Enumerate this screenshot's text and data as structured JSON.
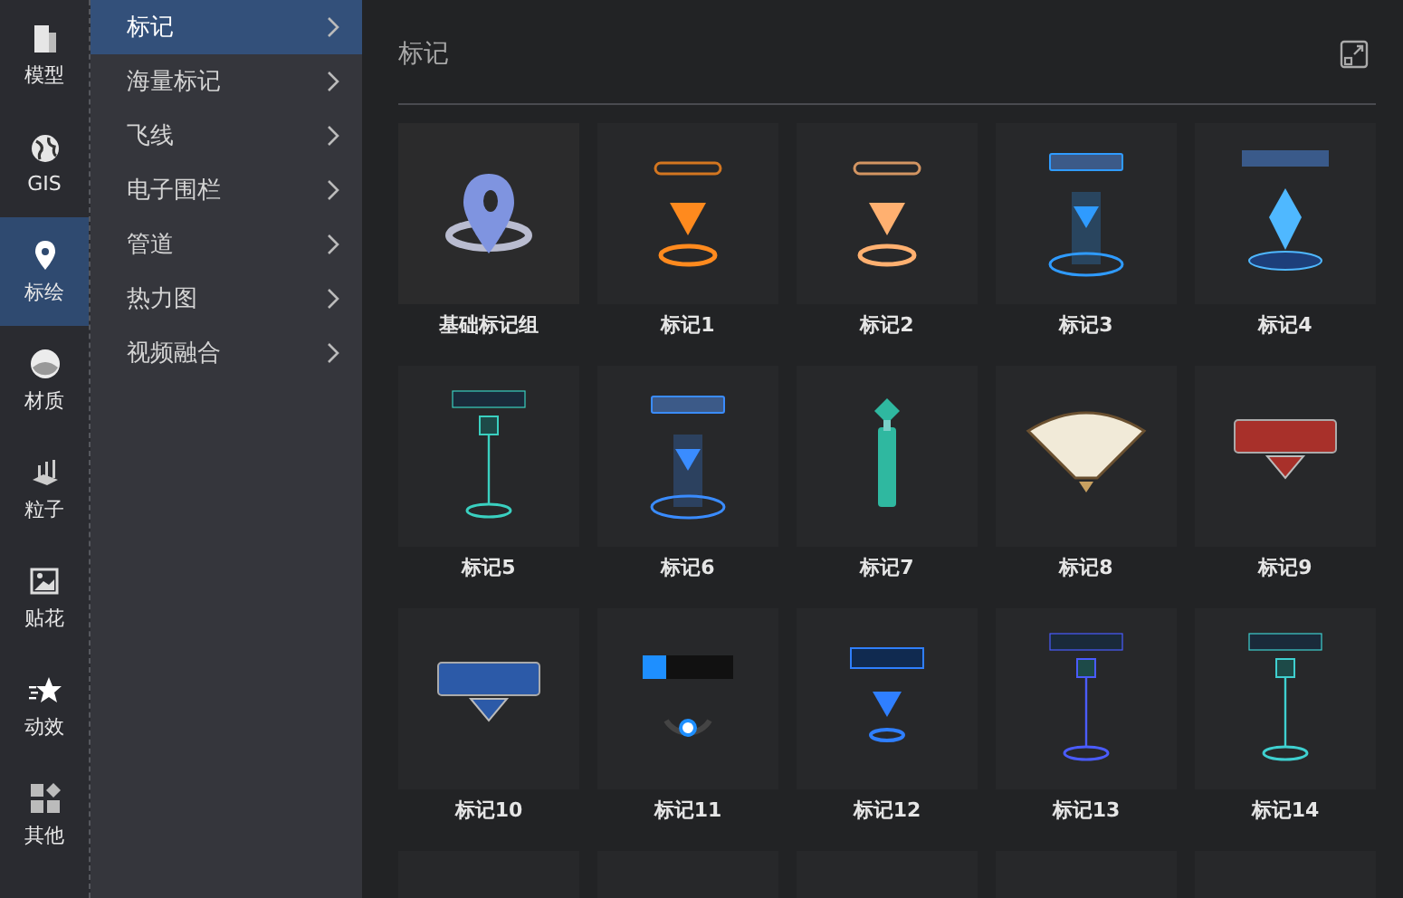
{
  "nav": [
    {
      "label": "模型",
      "kind": "building",
      "selected": false
    },
    {
      "label": "GIS",
      "kind": "globe",
      "selected": false
    },
    {
      "label": "标绘",
      "kind": "pin",
      "selected": true
    },
    {
      "label": "材质",
      "kind": "sphere",
      "selected": false
    },
    {
      "label": "粒子",
      "kind": "particles",
      "selected": false
    },
    {
      "label": "贴花",
      "kind": "image",
      "selected": false
    },
    {
      "label": "动效",
      "kind": "star",
      "selected": false
    },
    {
      "label": "其他",
      "kind": "grid",
      "selected": false
    }
  ],
  "submenu": [
    {
      "label": "标记",
      "selected": true
    },
    {
      "label": "海量标记",
      "selected": false
    },
    {
      "label": "飞线",
      "selected": false
    },
    {
      "label": "电子围栏",
      "selected": false
    },
    {
      "label": "管道",
      "selected": false
    },
    {
      "label": "热力图",
      "selected": false
    },
    {
      "label": "视频融合",
      "selected": false
    }
  ],
  "panel": {
    "title": "标记"
  },
  "tiles": [
    {
      "label": "基础标记组",
      "kind": "pin",
      "color": "#7f94e0"
    },
    {
      "label": "标记1",
      "kind": "gem",
      "color": "#ff8a1e"
    },
    {
      "label": "标记2",
      "kind": "gem",
      "color": "#ffb070"
    },
    {
      "label": "标记3",
      "kind": "pillar",
      "color": "#2f9bff"
    },
    {
      "label": "标记4",
      "kind": "crystal",
      "color": "#4fb8ff"
    },
    {
      "label": "标记5",
      "kind": "pole",
      "color": "#3ad0c0"
    },
    {
      "label": "标记6",
      "kind": "pillar",
      "color": "#3a8cff"
    },
    {
      "label": "标记7",
      "kind": "totem",
      "color": "#2fb8a0"
    },
    {
      "label": "标记8",
      "kind": "fan",
      "color": "#f1ead8"
    },
    {
      "label": "标记9",
      "kind": "sign",
      "color": "#a8302a"
    },
    {
      "label": "标记10",
      "kind": "sign",
      "color": "#2c5aa8"
    },
    {
      "label": "标记11",
      "kind": "loader",
      "color": "#1e8fff"
    },
    {
      "label": "标记12",
      "kind": "beacon",
      "color": "#2f7fff"
    },
    {
      "label": "标记13",
      "kind": "pole",
      "color": "#4a5cff"
    },
    {
      "label": "标记14",
      "kind": "pole",
      "color": "#3fd0d0"
    },
    {
      "kind": "blank"
    },
    {
      "kind": "blank"
    },
    {
      "kind": "blank"
    },
    {
      "kind": "blank"
    },
    {
      "kind": "blank"
    }
  ]
}
